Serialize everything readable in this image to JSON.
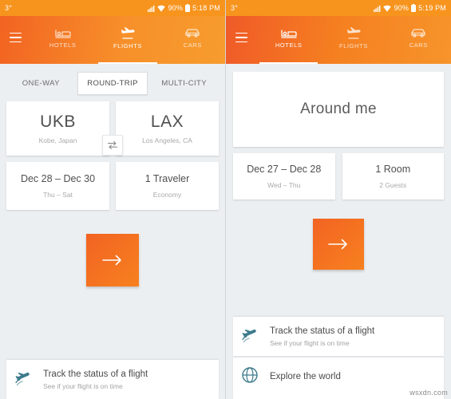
{
  "left": {
    "statusbar": {
      "left_text": "3°",
      "signal_icon": "signal-icon",
      "wifi_icon": "wifi-icon",
      "battery_text": "90%",
      "battery_icon": "battery-icon",
      "time": "5:18 PM"
    },
    "appbar": {
      "menu_icon": "hamburger-icon",
      "tabs": [
        {
          "label": "HOTELS",
          "icon": "hotel-bed-icon",
          "active": false
        },
        {
          "label": "FLIGHTS",
          "icon": "airplane-icon",
          "active": true
        },
        {
          "label": "CARS",
          "icon": "car-icon",
          "active": false
        }
      ]
    },
    "trip_types": [
      {
        "label": "ONE-WAY",
        "selected": false
      },
      {
        "label": "ROUND-TRIP",
        "selected": true
      },
      {
        "label": "MULTI-CITY",
        "selected": false
      }
    ],
    "origin": {
      "code": "UKB",
      "city": "Kobe, Japan"
    },
    "destination": {
      "code": "LAX",
      "city": "Los Angeles, CA"
    },
    "swap_icon": "swap-horizontal-icon",
    "dates": {
      "range": "Dec 28 – Dec 30",
      "days": "Thu – Sat"
    },
    "travelers": {
      "count": "1 Traveler",
      "class": "Economy"
    },
    "search_button": {
      "icon": "arrow-right-icon"
    },
    "promo": {
      "icon": "airplane-tracking-icon",
      "title": "Track the status of a flight",
      "desc": "See if your flight is on time"
    }
  },
  "right": {
    "statusbar": {
      "left_text": "3°",
      "signal_icon": "signal-icon",
      "wifi_icon": "wifi-icon",
      "battery_text": "90%",
      "battery_icon": "battery-icon",
      "time": "5:19 PM"
    },
    "appbar": {
      "menu_icon": "hamburger-icon",
      "tabs": [
        {
          "label": "HOTELS",
          "icon": "hotel-bed-icon",
          "active": true
        },
        {
          "label": "FLIGHTS",
          "icon": "airplane-icon",
          "active": false
        },
        {
          "label": "CARS",
          "icon": "car-icon",
          "active": false
        }
      ]
    },
    "location": {
      "title": "Around me"
    },
    "dates": {
      "range": "Dec 27 – Dec 28",
      "days": "Wed – Thu"
    },
    "rooms": {
      "count": "1 Room",
      "guests": "2 Guests"
    },
    "search_button": {
      "icon": "arrow-right-icon"
    },
    "promos": [
      {
        "icon": "airplane-tracking-icon",
        "title": "Track the status of a flight",
        "desc": "See if your flight is on time"
      },
      {
        "icon": "globe-icon",
        "title": "Explore the world",
        "desc": ""
      }
    ],
    "watermark": "wsxdn.com"
  },
  "colors": {
    "brand_orange": "#f7941e",
    "cta_gradient_start": "#f26322",
    "cta_gradient_end": "#f7811f",
    "page_bg": "#eceff1",
    "card_bg": "#ffffff",
    "text_primary": "#4a4a4a",
    "text_muted": "#a9a9a9",
    "accent_teal": "#3d7a8c"
  }
}
